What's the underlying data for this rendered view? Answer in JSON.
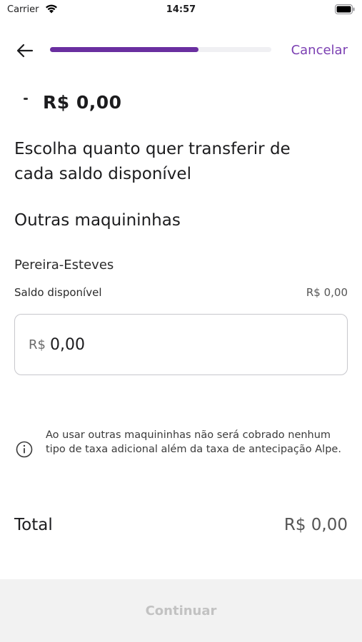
{
  "status_bar": {
    "carrier": "Carrier",
    "time": "14:57"
  },
  "header": {
    "back_icon": "arrow-left-icon",
    "progress": 0.67,
    "progress_color": "#6a2fa0",
    "cancel_label": "Cancelar",
    "accent_color": "#7b3fb2"
  },
  "main": {
    "clipped_amount": "R$ 0,00",
    "heading": "Escolha quanto quer transferir de cada saldo disponível",
    "section_title": "Outras maquininhas",
    "account": {
      "name": "Pereira-Esteves",
      "balance_label": "Saldo disponível",
      "balance_value": "R$ 0,00"
    },
    "amount_input": {
      "currency": "R$",
      "value": "0,00"
    },
    "info": {
      "icon": "info-icon",
      "text": "Ao usar outras maquininhas não será cobrado nenhum tipo de taxa adicional além da taxa de antecipação Alpe."
    },
    "total": {
      "label": "Total",
      "value": "R$ 0,00"
    }
  },
  "footer": {
    "continue_label": "Continuar"
  }
}
